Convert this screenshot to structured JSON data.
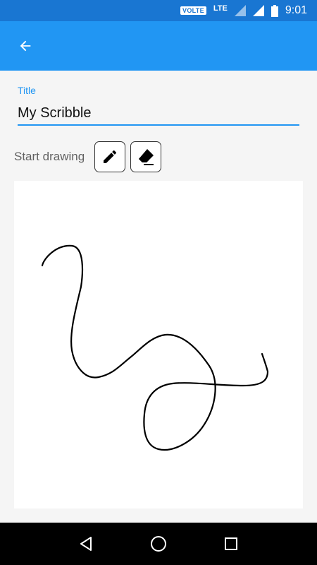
{
  "status_bar": {
    "volte": "VOLTE",
    "lte": "LTE",
    "time": "9:01",
    "icons": [
      "signal-icon",
      "signal-icon",
      "battery-icon"
    ]
  },
  "app_bar": {
    "back_icon": "arrow-left-icon",
    "color": "#2196f3"
  },
  "form": {
    "title_label": "Title",
    "title_value": "My Scribble",
    "start_label": "Start drawing",
    "accent": "#2196f3"
  },
  "tools": [
    {
      "name": "pen",
      "icon": "pencil-icon"
    },
    {
      "name": "eraser",
      "icon": "eraser-icon"
    }
  ],
  "nav_bar": {
    "icons": [
      "back-triangle-icon",
      "home-circle-icon",
      "recents-square-icon"
    ]
  }
}
